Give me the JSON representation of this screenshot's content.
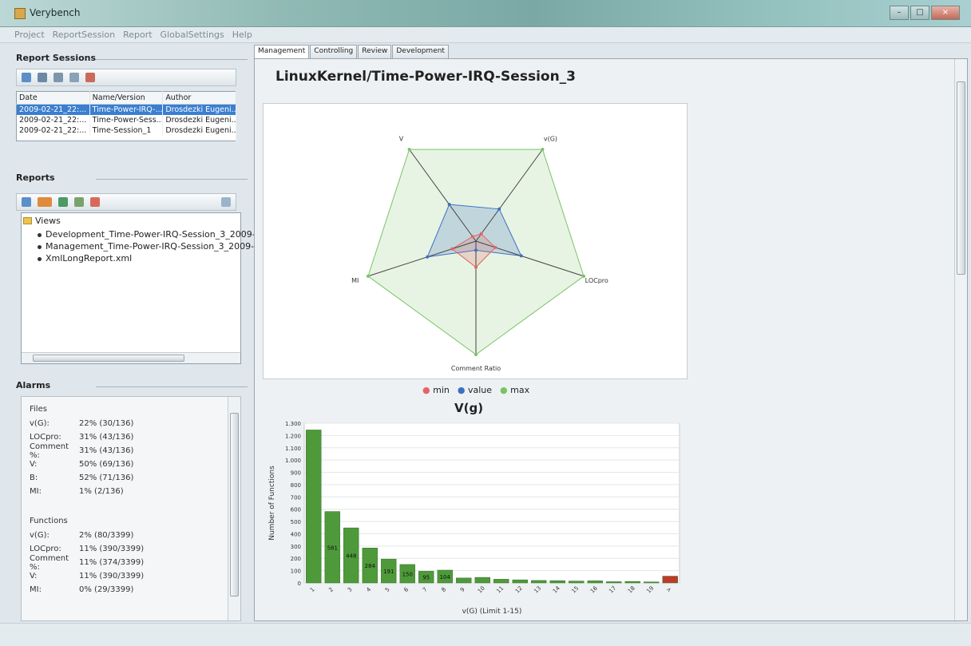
{
  "window": {
    "title": "Verybench"
  },
  "menu": [
    "Project",
    "ReportSession",
    "Report",
    "GlobalSettings",
    "Help"
  ],
  "report_sessions": {
    "heading": "Report Sessions",
    "columns": [
      "Date",
      "Name/Version",
      "Author"
    ],
    "rows": [
      [
        "2009-02-21_22:...",
        "Time-Power-IRQ-...",
        "Drosdezki Eugeni..."
      ],
      [
        "2009-02-21_22:...",
        "Time-Power-Sess...",
        "Drosdezki Eugeni..."
      ],
      [
        "2009-02-21_22:...",
        "Time-Session_1",
        "Drosdezki Eugeni..."
      ]
    ]
  },
  "reports": {
    "heading": "Reports",
    "tree_root": "Views",
    "items": [
      "Development_Time-Power-IRQ-Session_3_2009-02-2",
      "Management_Time-Power-IRQ-Session_3_2009-02-2",
      "XmlLongReport.xml"
    ]
  },
  "alarms": {
    "heading": "Alarms",
    "files": {
      "title": "Files",
      "rows": [
        [
          "v(G):",
          "22% (30/136)"
        ],
        [
          "LOCpro:",
          "31% (43/136)"
        ],
        [
          "Comment %:",
          "31% (43/136)"
        ],
        [
          "V:",
          "50% (69/136)"
        ],
        [
          "B:",
          "52% (71/136)"
        ],
        [
          "MI:",
          "1% (2/136)"
        ]
      ]
    },
    "functions": {
      "title": "Functions",
      "rows": [
        [
          "v(G):",
          "2% (80/3399)"
        ],
        [
          "LOCpro:",
          "11% (390/3399)"
        ],
        [
          "Comment %:",
          "11% (374/3399)"
        ],
        [
          "V:",
          "11% (390/3399)"
        ],
        [
          "MI:",
          "0% (29/3399)"
        ]
      ]
    }
  },
  "tabs": [
    "Management",
    "Controlling",
    "Review",
    "Development"
  ],
  "page_title": "LinuxKernel/Time-Power-IRQ-Session_3",
  "colors": {
    "min": "#e06666",
    "value": "#3d6fc4",
    "max": "#78c466",
    "bar": "#4e9a3a",
    "bar_last": "#c0392b"
  },
  "chart_data": [
    {
      "type": "radar",
      "axes": [
        "V",
        "v(G)",
        "LOCpro",
        "Comment Ratio",
        "MI"
      ],
      "series": [
        {
          "name": "min",
          "values": [
            0.05,
            0.08,
            0.18,
            0.23,
            0.22
          ]
        },
        {
          "name": "value",
          "values": [
            0.4,
            0.35,
            0.42,
            0.08,
            0.45
          ]
        },
        {
          "name": "max",
          "values": [
            1,
            1,
            1,
            1,
            1
          ]
        }
      ],
      "legend": [
        "min",
        "value",
        "max"
      ]
    },
    {
      "type": "bar",
      "title": "V(g)",
      "xlabel": "v(G) (Limit 1-15)",
      "ylabel": "Number of Functions",
      "ylim": [
        0,
        1300
      ],
      "yticks": [
        "0",
        "100",
        "200",
        "300",
        "400",
        "500",
        "600",
        "700",
        "800",
        "900",
        "1.000",
        "1.100",
        "1.200",
        "1.300"
      ],
      "categories": [
        "1",
        "2",
        "3",
        "4",
        "5",
        "6",
        "7",
        "8",
        "9",
        "10",
        "11",
        "12",
        "13",
        "14",
        "15",
        "16",
        "17",
        "18",
        "19",
        ">"
      ],
      "values": [
        1245,
        581,
        448,
        284,
        194,
        150,
        95,
        104,
        40,
        45,
        30,
        25,
        20,
        18,
        15,
        17,
        10,
        12,
        8,
        55
      ],
      "data_labels": [
        "",
        "581",
        "448",
        "284",
        "191",
        "150",
        "95",
        "104",
        "",
        "",
        "",
        "",
        "",
        "",
        "",
        "",
        "",
        "",
        "",
        ""
      ]
    }
  ]
}
